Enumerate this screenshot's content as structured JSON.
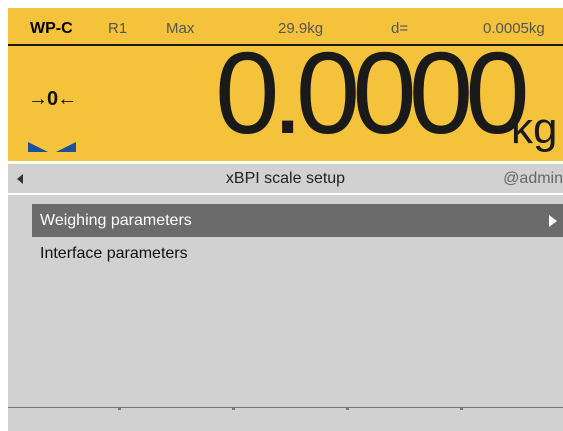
{
  "header_info": {
    "model": "WP-C",
    "range": "R1",
    "max_label": "Max",
    "max_value": "29.9kg",
    "d_label": "d=",
    "d_value": "0.0005kg"
  },
  "display": {
    "zero_indicator": "→0←",
    "weight": "0.0000",
    "unit": "kg",
    "stability_icon": "stability-triangles"
  },
  "menu_header": {
    "back_icon": "triangle-left",
    "title": "xBPI scale setup",
    "user": "@admin"
  },
  "menu": {
    "items": [
      {
        "label": "Weighing parameters",
        "selected": true,
        "has_submenu": true
      },
      {
        "label": "Interface parameters",
        "selected": false,
        "has_submenu": false
      }
    ]
  },
  "colors": {
    "display_bg": "#f5c33b",
    "panel_bg": "#d1d1d1",
    "selected_bg": "#6b6b6b"
  }
}
